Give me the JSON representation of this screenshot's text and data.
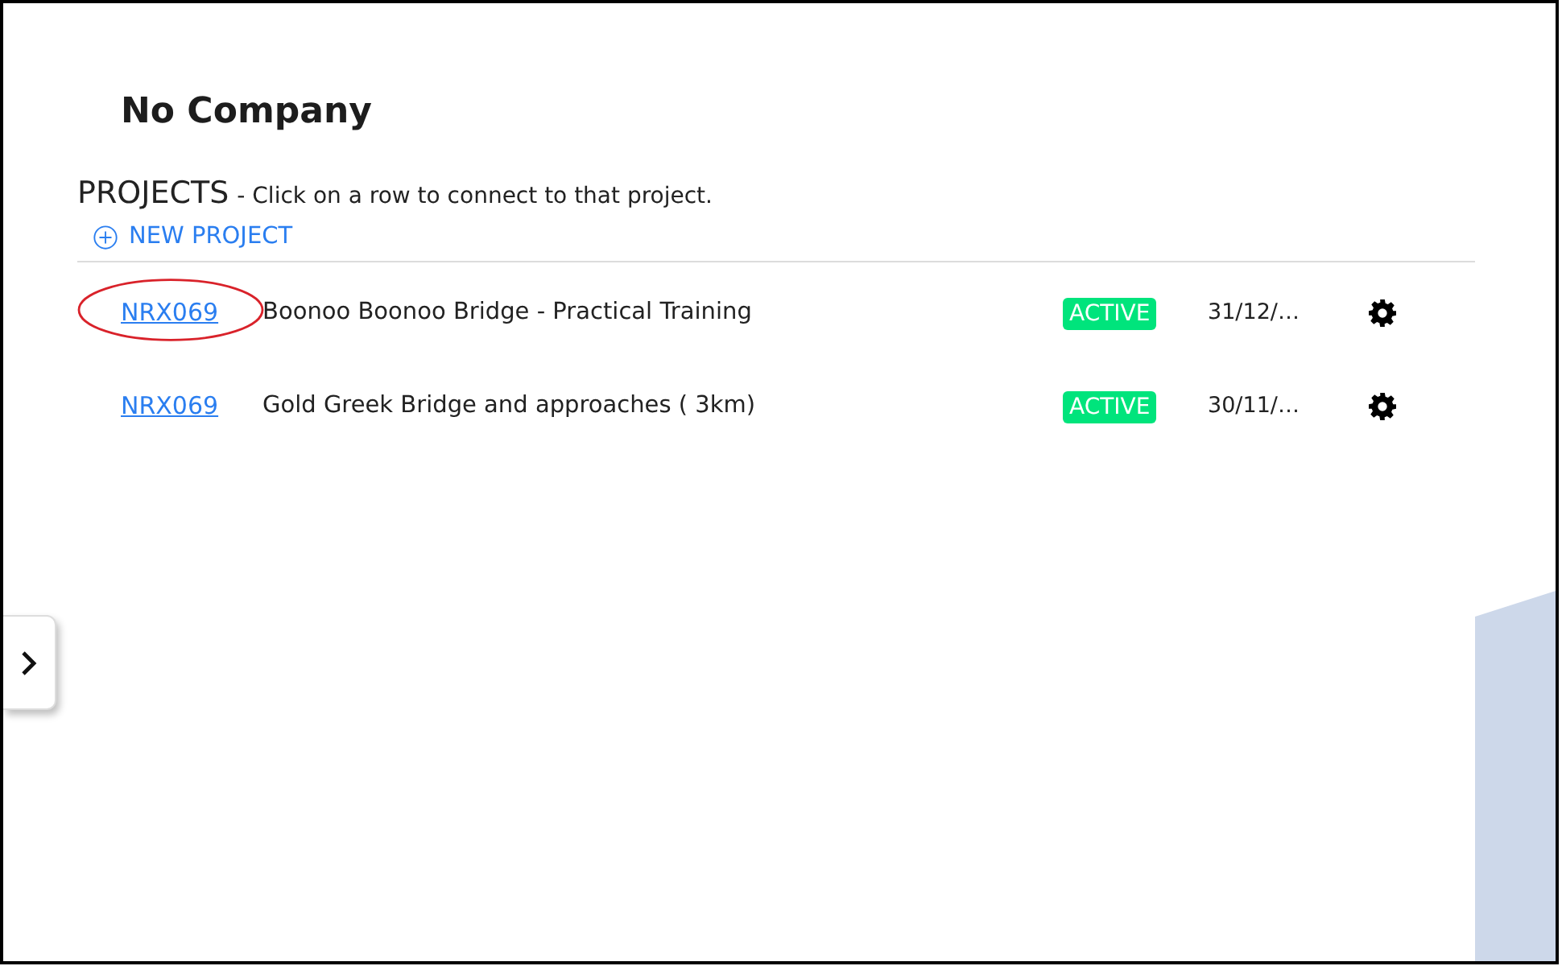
{
  "company": {
    "title": "No Company"
  },
  "projects": {
    "heading": "PROJECTS",
    "hint": "- Click on a row to connect to that project.",
    "new_project": {
      "label": "NEW PROJECT"
    },
    "rows": [
      {
        "code": "NRX069",
        "name": "Boonoo Boonoo Bridge - Practical Training",
        "status": "ACTIVE",
        "date": "31/12/…",
        "circled": true
      },
      {
        "code": "NRX069",
        "name": "Gold Greek Bridge and approaches ( 3km)",
        "status": "ACTIVE",
        "date": "30/11/…",
        "circled": false
      }
    ]
  },
  "side_panel": {
    "expanded": false
  }
}
